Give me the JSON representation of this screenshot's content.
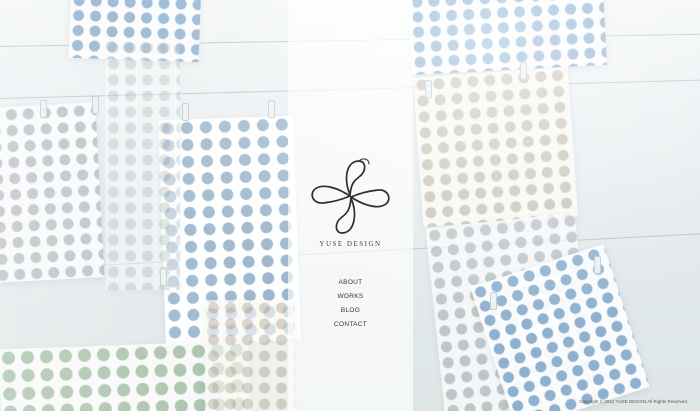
{
  "brand": {
    "name": "YUSE DESIGN"
  },
  "nav": {
    "items": [
      {
        "label": "ABOUT"
      },
      {
        "label": "WORKS"
      },
      {
        "label": "BLOG"
      },
      {
        "label": "CONTACT"
      }
    ]
  },
  "footer": {
    "copyright": "Copyright © 2012 YUSE DESIGN All Rights Reserved."
  },
  "colors": {
    "column": "#ffffff",
    "text": "#333333",
    "dots_blue": "#9db6cc"
  }
}
